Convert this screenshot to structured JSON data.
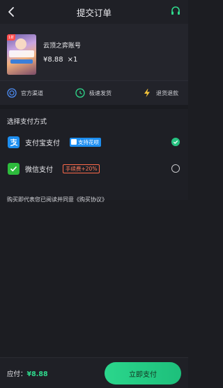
{
  "header": {
    "title": "提交订单"
  },
  "product": {
    "badge": "1折",
    "name": "云顶之弈账号",
    "price": "¥8.88",
    "quantity": "×1"
  },
  "features": [
    {
      "label": "官方渠道",
      "icon": "official-channel-icon"
    },
    {
      "label": "极速发货",
      "icon": "clock-icon"
    },
    {
      "label": "退货退款",
      "icon": "lightning-icon"
    }
  ],
  "payment": {
    "section_title": "选择支付方式",
    "methods": [
      {
        "label": "支付宝支付",
        "tag": "支持花呗",
        "selected": true
      },
      {
        "label": "微信支付",
        "tag": "手续费+20%",
        "selected": false
      }
    ],
    "agreement": "购买即代表您已阅读并同意《购买协议》"
  },
  "footer": {
    "due_label": "应付：",
    "due_value": "¥8.88",
    "pay_button": "立即支付"
  },
  "colors": {
    "accent_green": "#27c281",
    "alipay_blue": "#1d8ef0",
    "wechat_green": "#2dbb3c",
    "fee_red": "#ff6a4a"
  }
}
